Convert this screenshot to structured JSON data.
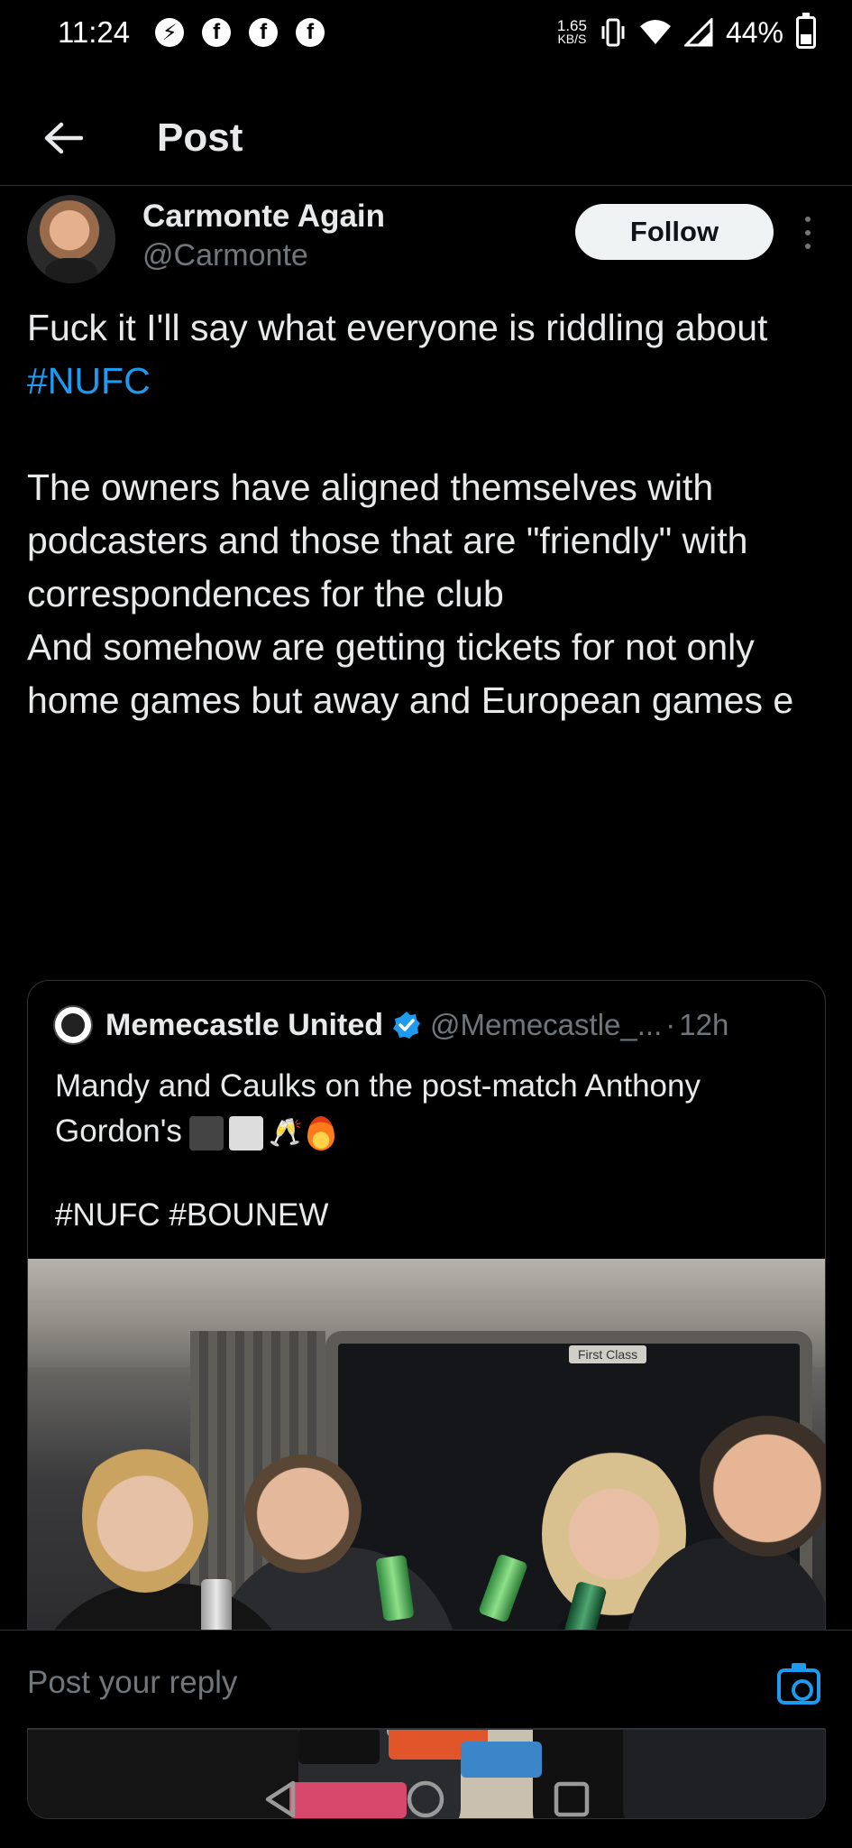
{
  "status_bar": {
    "time": "11:24",
    "notification_icons": [
      "messenger-icon",
      "facebook-icon",
      "facebook-icon",
      "facebook-icon"
    ],
    "network_speed_value": "1.65",
    "network_speed_unit": "KB/S",
    "battery_percent": "44%",
    "battery_level": 0.44
  },
  "header": {
    "title": "Post"
  },
  "post": {
    "author_name": "Carmonte Again",
    "author_handle": "@Carmonte",
    "follow_label": "Follow",
    "text_part1": "Fuck it I'll say what everyone is riddling about ",
    "hashtag": "#NUFC",
    "text_part2": "\n\nThe owners have aligned themselves with podcasters and those that are \"friendly\" with correspondences for the club\nAnd somehow are getting tickets for not only home games but away and European games e"
  },
  "quote": {
    "name": "Memecastle United",
    "handle": "@Memecastle_...",
    "separator": "·",
    "time": "12h",
    "text": "Mandy and Caulks on the post-match Anthony Gordon's",
    "emoji_names": [
      "black-square",
      "white-square",
      "clinking-glasses",
      "fire"
    ],
    "tags": "#NUFC #BOUNEW",
    "photo_sign": "First Class"
  },
  "reply": {
    "placeholder": "Post your reply"
  },
  "colors": {
    "background": "#000000",
    "text": "#e7e9ea",
    "muted": "#71767b",
    "accent": "#1d9bf0",
    "follow_bg": "#eff3f4"
  }
}
